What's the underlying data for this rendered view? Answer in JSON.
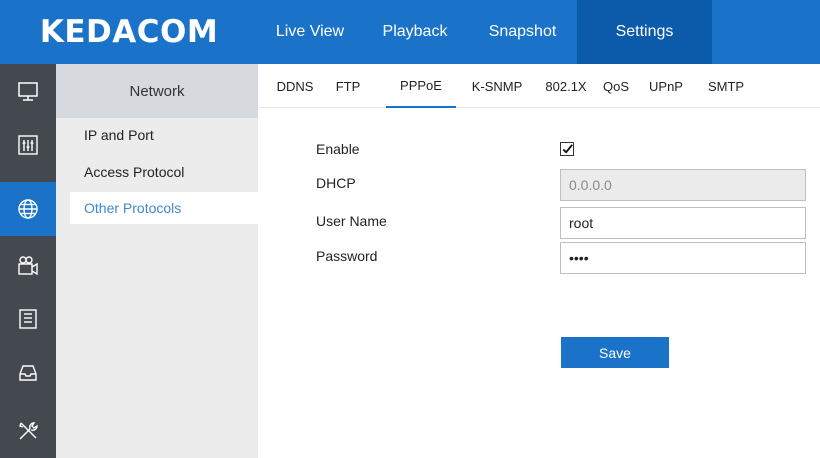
{
  "brand": {
    "logo_text": "KEDACOM"
  },
  "top_nav": [
    {
      "label": "Live View",
      "active": false
    },
    {
      "label": "Playback",
      "active": false
    },
    {
      "label": "Snapshot",
      "active": false
    },
    {
      "label": "Settings",
      "active": true
    }
  ],
  "rail_icons": [
    {
      "icon": "monitor-icon",
      "active": false
    },
    {
      "icon": "equalizer-icon",
      "active": false
    },
    {
      "icon": "network-globe-icon",
      "active": true
    },
    {
      "icon": "camera-icon",
      "active": false
    },
    {
      "icon": "document-list-icon",
      "active": false
    },
    {
      "icon": "storage-tray-icon",
      "active": false
    },
    {
      "icon": "tools-icon",
      "active": false
    }
  ],
  "side_menu": {
    "heading": "Network",
    "items": [
      {
        "label": "IP and Port",
        "active": false
      },
      {
        "label": "Access Protocol",
        "active": false
      },
      {
        "label": "Other Protocols",
        "active": true
      }
    ]
  },
  "tabs": [
    {
      "label": "DDNS",
      "active": false
    },
    {
      "label": "FTP",
      "active": false
    },
    {
      "label": "PPPoE",
      "active": true
    },
    {
      "label": "K-SNMP",
      "active": false
    },
    {
      "label": "802.1X",
      "active": false
    },
    {
      "label": "QoS",
      "active": false
    },
    {
      "label": "UPnP",
      "active": false
    },
    {
      "label": "SMTP",
      "active": false
    }
  ],
  "form": {
    "enable_label": "Enable",
    "enable_checked": true,
    "dhcp_label": "DHCP",
    "dhcp_value": "0.0.0.0",
    "username_label": "User Name",
    "username_value": "root",
    "password_label": "Password",
    "password_value": "kdac",
    "save_label": "Save"
  },
  "colors": {
    "primary": "#1a73c9",
    "primary_dark": "#0c5bab",
    "rail_bg": "#43494f",
    "menu_bg": "#ececec",
    "active_link": "#3f86d1"
  }
}
